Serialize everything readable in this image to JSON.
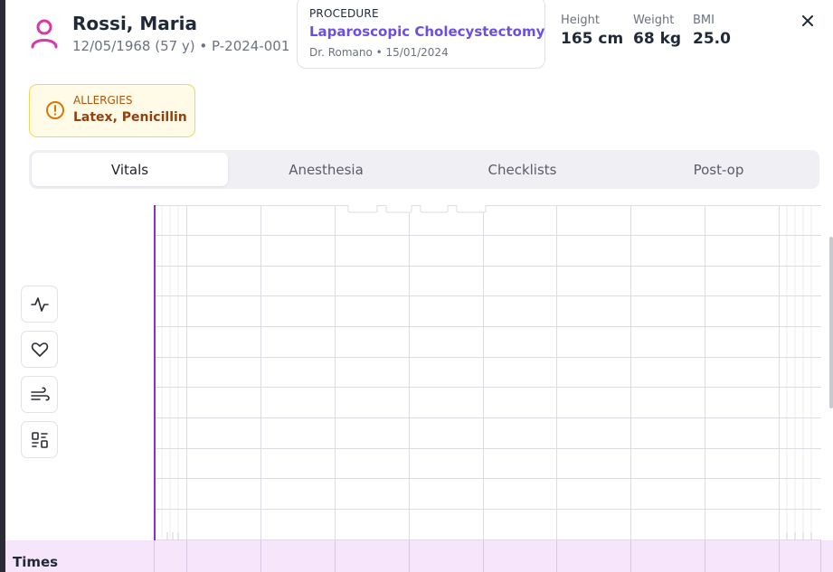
{
  "patient": {
    "name": "Rossi, Maria",
    "meta": "12/05/1968 (57 y) • P-2024-001"
  },
  "procedure": {
    "label": "PROCEDURE",
    "name": "Laparoscopic Cholecystectomy",
    "sub": "Dr. Romano • 15/01/2024"
  },
  "stats": [
    {
      "label": "Height",
      "value": "165 cm"
    },
    {
      "label": "Weight",
      "value": "68 kg"
    },
    {
      "label": "BMI",
      "value": "25.0"
    }
  ],
  "allergies": {
    "label": "ALLERGIES",
    "value": "Latex, Penicillin"
  },
  "tabs": [
    {
      "label": "Vitals",
      "active": true
    },
    {
      "label": "Anesthesia",
      "active": false
    },
    {
      "label": "Checklists",
      "active": false
    },
    {
      "label": "Post-op",
      "active": false
    }
  ],
  "tools": [
    {
      "icon": "activity-icon"
    },
    {
      "icon": "heart-icon"
    },
    {
      "icon": "wind-icon"
    },
    {
      "icon": "layout-icon"
    }
  ],
  "times_label": "Times",
  "colors": {
    "accent": "#6d4fe0",
    "patient_icon": "#d63aa6",
    "allergy_bg": "#fffbe6",
    "allergy_border": "#f0d75c",
    "allergy_text": "#92400e",
    "chart_line": "#8a2fc7",
    "times_bg": "#f7e6fb"
  }
}
